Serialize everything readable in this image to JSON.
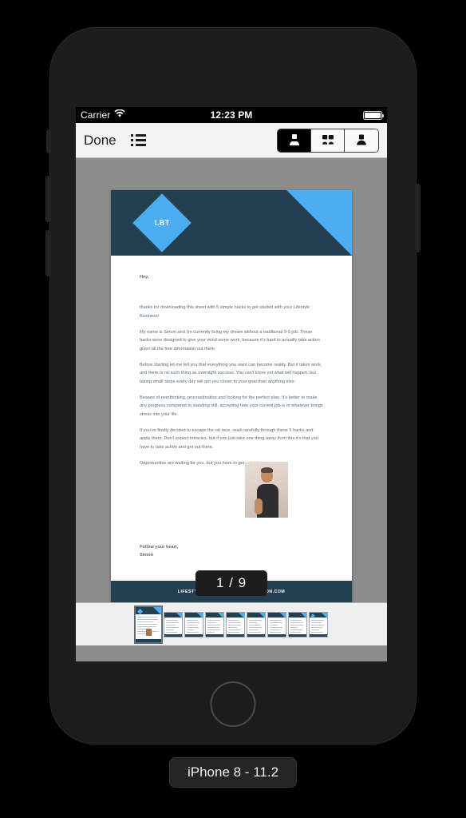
{
  "device": {
    "label": "iPhone 8 - 11.2",
    "home_button": "home-button"
  },
  "status_bar": {
    "carrier": "Carrier",
    "wifi_icon": "wifi-icon",
    "time": "12:23 PM",
    "battery_icon": "battery-full-icon"
  },
  "toolbar": {
    "done_label": "Done",
    "list_icon": "list-icon",
    "segmented_control": {
      "selected_index": 0,
      "options": [
        {
          "icon": "single-page-view-icon",
          "label": "Single Page"
        },
        {
          "icon": "two-page-view-icon",
          "label": "Two Page"
        },
        {
          "icon": "continuous-page-view-icon",
          "label": "Continuous"
        }
      ]
    }
  },
  "document": {
    "logo_text": "LBT",
    "greeting": "Hey,",
    "paragraphs": [
      "thanks for downloading this sheet with 5 simple hacks to get started with your Lifestyle Business!",
      "My name is Simon and I'm currently living my dream without a traditional 9-5 job. These hacks were designed to give your mind some work, because it's hard to actually take action given all the free information out there.",
      "Before starting let me tell you that everything you want can become reality. But it takes work, and there is no such thing as overnight success. You can't know yet what will happen, but taking small steps every day will get you closer to your goal than anything else.",
      "Beware of overthinking, procrastination and looking for the perfect plan. It's better to make any progress compared to standing still, accepting how your current job is or whatever brings stress into your life.",
      "If you've finally decided to escape the rat race, read carefully through these 5 hacks and apply them. Don't expect miracles, but if you just take one thing away from this it's that you have to take action and get out there.",
      "Opportunities are waiting for you, but you have to get outside!"
    ],
    "signoff_line1": "Follow your heart,",
    "signoff_line2": "Simon",
    "author_photo": "author-photo",
    "footer_url": "LIFESTYLEBUSINESSTRANSFORMATION.COM"
  },
  "page_indicator": {
    "text": "1 / 9",
    "current": 1,
    "total": 9
  },
  "thumbnails": {
    "count": 9,
    "current_index": 1
  },
  "colors": {
    "header_navy": "#22404f",
    "accent_blue": "#4cadf0",
    "screen_background": "#8c8c8c",
    "toolbar_background": "#f3f3f3",
    "device_body": "#1c1c1c"
  }
}
